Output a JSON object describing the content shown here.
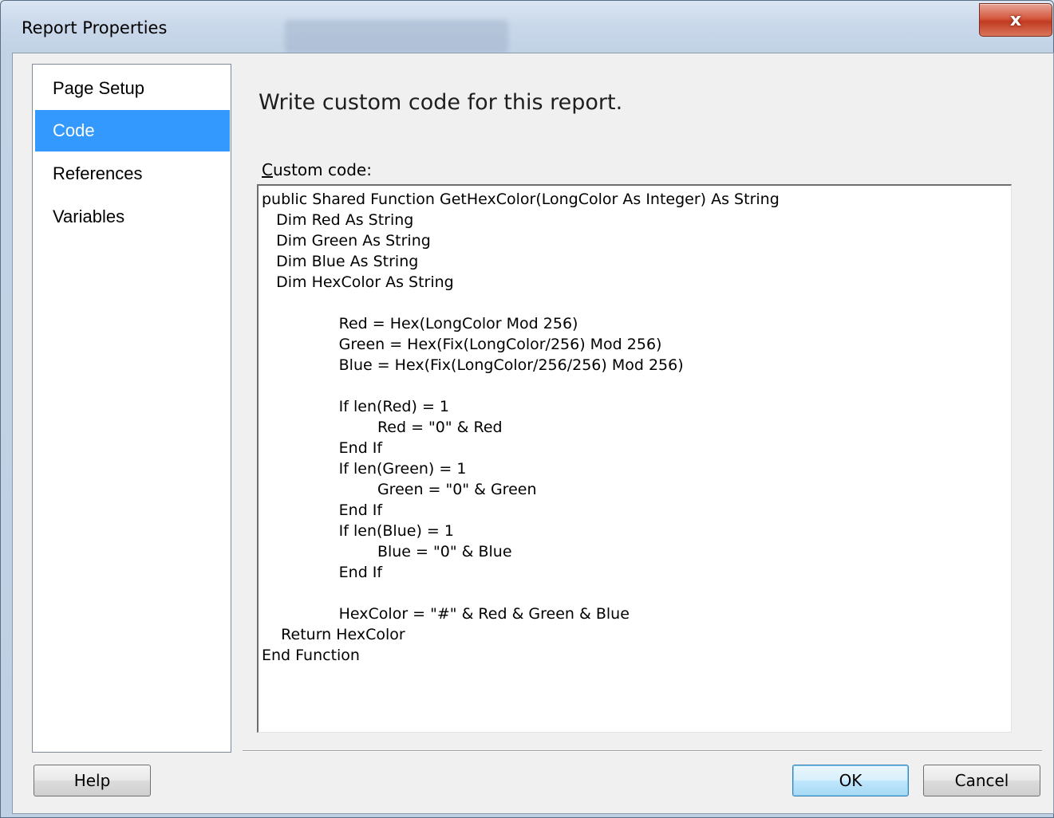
{
  "window": {
    "title": "Report Properties",
    "close_glyph": "x"
  },
  "nav": {
    "items": [
      {
        "label": "Page Setup",
        "selected": false
      },
      {
        "label": "Code",
        "selected": true
      },
      {
        "label": "References",
        "selected": false
      },
      {
        "label": "Variables",
        "selected": false
      }
    ]
  },
  "main": {
    "heading": "Write custom code for this report.",
    "code_label_accesskey": "C",
    "code_label_rest": "ustom code:",
    "code": "public Shared Function GetHexColor(LongColor As Integer) As String\n   Dim Red As String\n   Dim Green As String\n   Dim Blue As String\n   Dim HexColor As String\n\n\t\tRed = Hex(LongColor Mod 256)\n\t\tGreen = Hex(Fix(LongColor/256) Mod 256)\n\t\tBlue = Hex(Fix(LongColor/256/256) Mod 256)\n\n\t\tIf len(Red) = 1\n\t\t\tRed = \"0\" & Red\n\t\tEnd If\n\t\tIf len(Green) = 1\n\t\t\tGreen = \"0\" & Green\n\t\tEnd If\n\t\tIf len(Blue) = 1\n\t\t\tBlue = \"0\" & Blue\n\t\tEnd If\n\n\t\tHexColor = \"#\" & Red & Green & Blue\n    Return HexColor\nEnd Function"
  },
  "buttons": {
    "help": "Help",
    "ok": "OK",
    "cancel": "Cancel"
  },
  "colors": {
    "selection": "#3399ff",
    "close_button": "#c23b20"
  }
}
